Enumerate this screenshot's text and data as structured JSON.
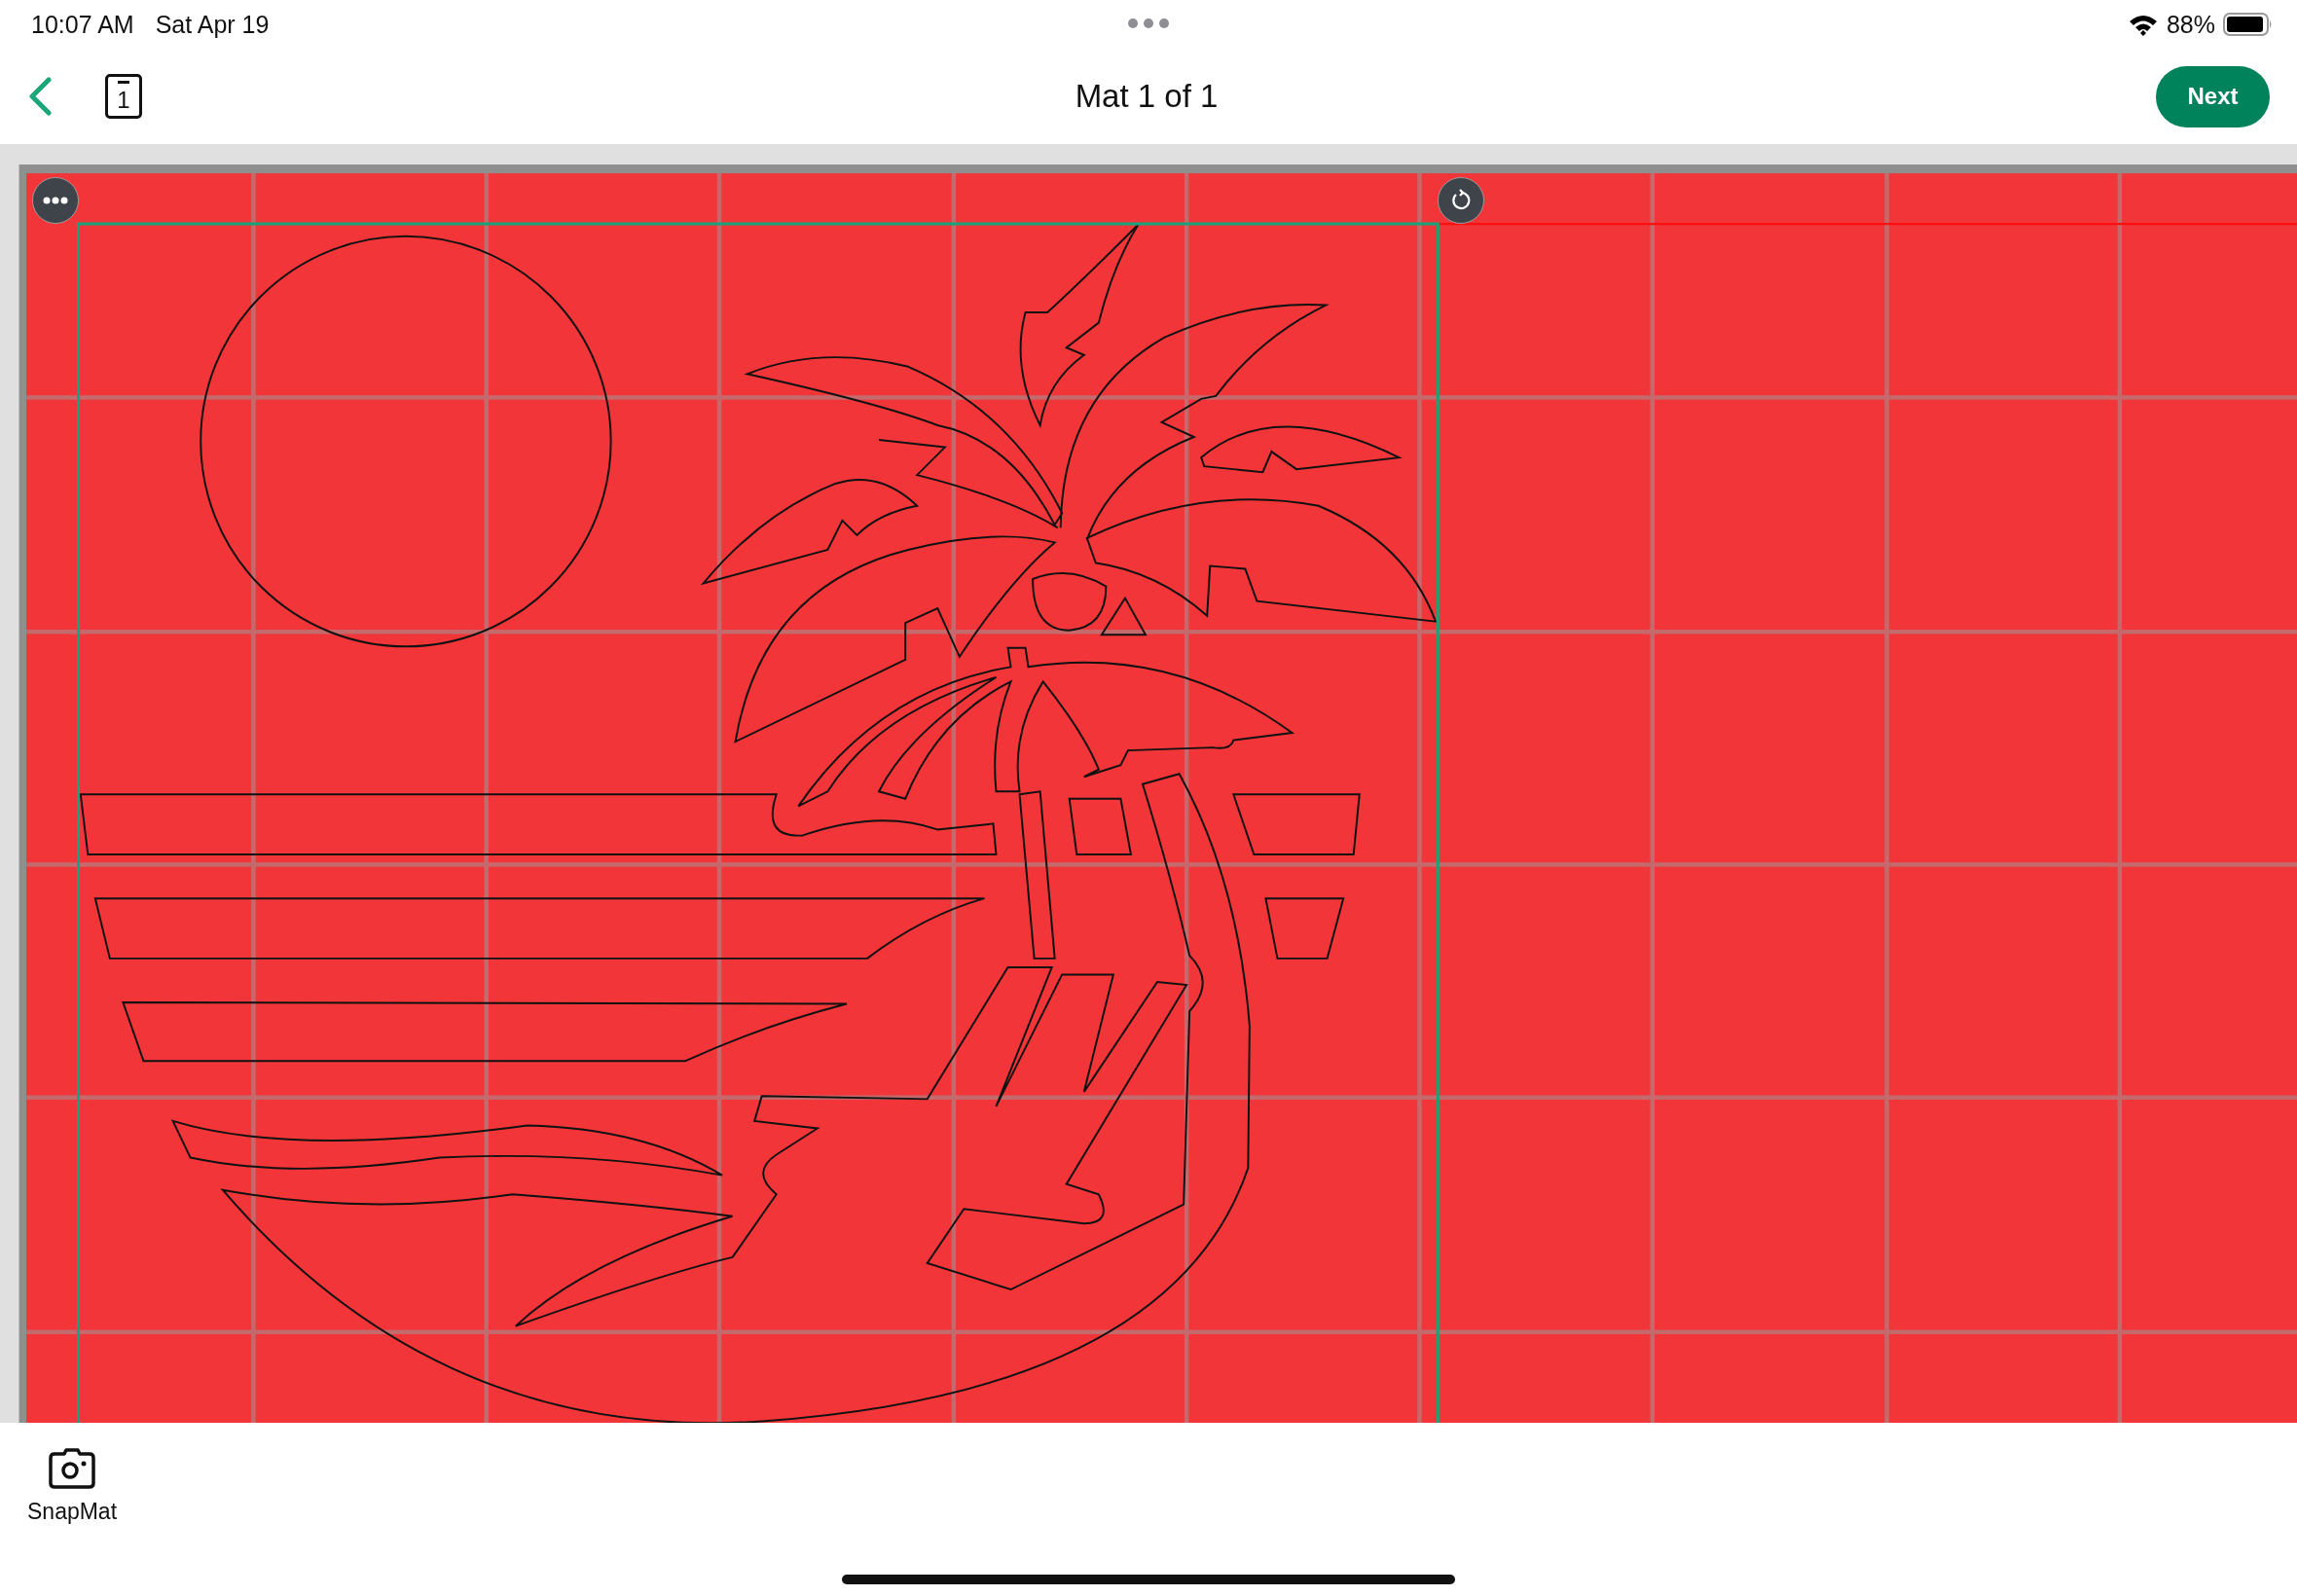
{
  "status_bar": {
    "time": "10:07 AM",
    "date": "Sat Apr 19",
    "battery": "88%"
  },
  "nav_bar": {
    "mat_number": "1",
    "title": "Mat 1 of 1",
    "next_button": "Next"
  },
  "bottom_bar": {
    "tools": [
      {
        "label": "SnapMat"
      }
    ]
  }
}
